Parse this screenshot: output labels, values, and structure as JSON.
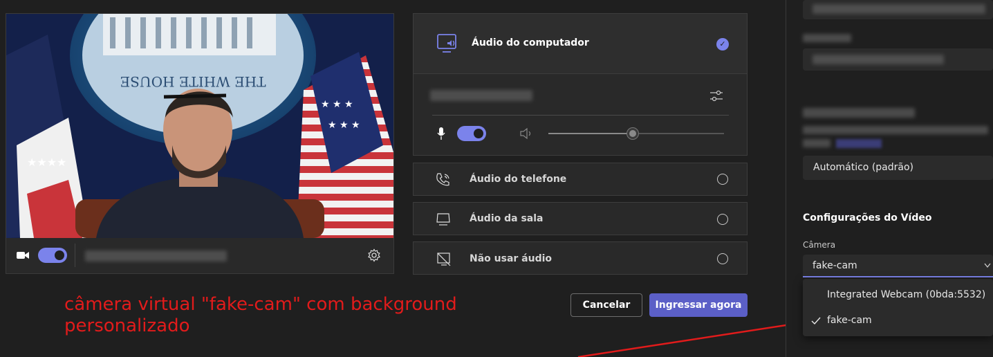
{
  "video": {
    "camera_toggle_on": true,
    "camera_name_blurred": true
  },
  "audio_options": {
    "computer": {
      "label": "Áudio do computador",
      "selected": true
    },
    "device_name_blurred": true,
    "mic_toggle_on": true,
    "volume_fraction": 0.5,
    "phone": {
      "label": "Áudio do telefone",
      "selected": false
    },
    "room": {
      "label": "Áudio da sala",
      "selected": false
    },
    "none": {
      "label": "Não usar áudio",
      "selected": false
    }
  },
  "actions": {
    "cancel_label": "Cancelar",
    "join_label": "Ingressar agora"
  },
  "annotation": {
    "text": "câmera virtual \"fake-cam\" com background personalizado",
    "color": "#e21b1b"
  },
  "settings_panel": {
    "auto_value": "Automático (padrão)",
    "video_section_title": "Configurações do Vídeo",
    "camera_label": "Câmera",
    "camera_value": "fake-cam",
    "camera_options": [
      {
        "label": "Integrated Webcam (0bda:5532)",
        "selected": false
      },
      {
        "label": "fake-cam",
        "selected": true
      }
    ]
  },
  "colors": {
    "accent": "#7b83eb",
    "primary_button": "#5b5fc7",
    "background": "#1f1f1f"
  }
}
